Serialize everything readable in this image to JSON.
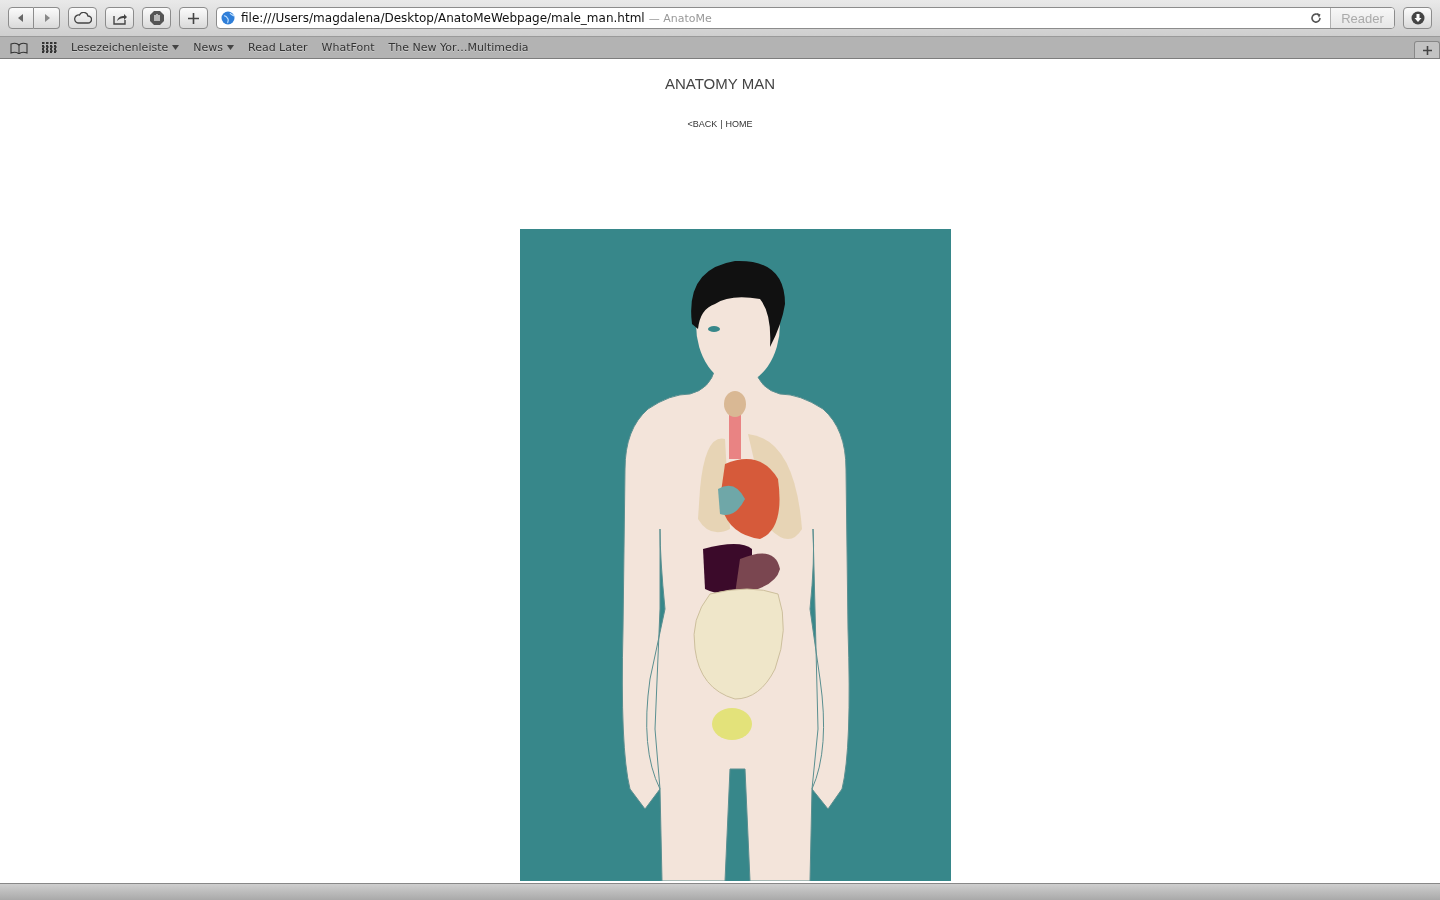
{
  "toolbar": {
    "address": "file:///Users/magdalena/Desktop/AnatoMeWebpage/male_man.html",
    "page_title": "— AnatoMe",
    "reader_button": "Reader"
  },
  "bookmarks": [
    {
      "label": "Lesezeichenleiste",
      "kind": "menu"
    },
    {
      "label": "News",
      "kind": "menu"
    },
    {
      "label": "Read Later",
      "kind": "link"
    },
    {
      "label": "WhatFont",
      "kind": "link"
    },
    {
      "label": "The New Yor…Multimedia",
      "kind": "link"
    }
  ],
  "page": {
    "heading": "ANATOMY MAN",
    "nav": {
      "back": "<BACK",
      "separator": "|",
      "home": "HOME"
    }
  }
}
